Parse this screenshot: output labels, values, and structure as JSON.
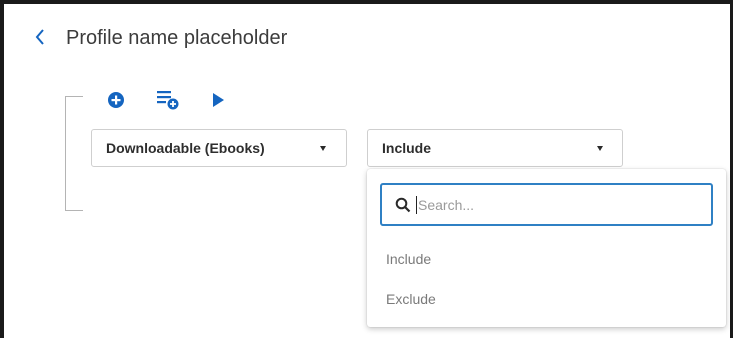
{
  "header": {
    "title": "Profile name placeholder",
    "back_icon": "chevron-left-icon"
  },
  "toolbar": {
    "buttons": [
      {
        "icon": "plus-circle-icon",
        "name": "add-rule-button"
      },
      {
        "icon": "add-group-icon",
        "name": "add-group-button"
      },
      {
        "icon": "play-icon",
        "name": "run-button"
      }
    ]
  },
  "rule": {
    "category_value": "Downloadable (Ebooks)",
    "condition_value": "Include"
  },
  "dropdown": {
    "search_placeholder": "Search...",
    "options": [
      "Include",
      "Exclude"
    ]
  },
  "colors": {
    "accent": "#1565c0",
    "focus_border": "#2f80c4"
  }
}
